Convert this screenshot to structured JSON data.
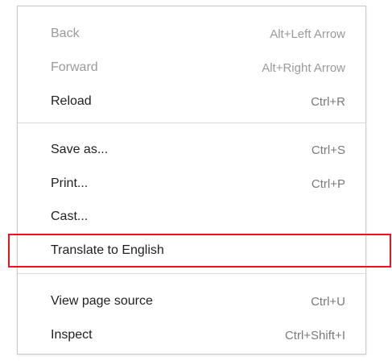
{
  "context_menu": {
    "items": [
      {
        "label": "Back",
        "shortcut": "Alt+Left Arrow",
        "disabled": true
      },
      {
        "label": "Forward",
        "shortcut": "Alt+Right Arrow",
        "disabled": true
      },
      {
        "label": "Reload",
        "shortcut": "Ctrl+R",
        "disabled": false
      },
      {
        "label": "Save as...",
        "shortcut": "Ctrl+S",
        "disabled": false
      },
      {
        "label": "Print...",
        "shortcut": "Ctrl+P",
        "disabled": false
      },
      {
        "label": "Cast...",
        "shortcut": "",
        "disabled": false
      },
      {
        "label": "Translate to English",
        "shortcut": "",
        "disabled": false,
        "highlighted": true
      },
      {
        "label": "View page source",
        "shortcut": "Ctrl+U",
        "disabled": false
      },
      {
        "label": "Inspect",
        "shortcut": "Ctrl+Shift+I",
        "disabled": false
      }
    ]
  },
  "colors": {
    "text": "#1f1f1f",
    "disabled_text": "#9a9a9a",
    "shortcut_text": "#7a7a7a",
    "separator": "#dadada",
    "highlight_border": "#e8141e",
    "menu_border": "#c8c8c8"
  }
}
